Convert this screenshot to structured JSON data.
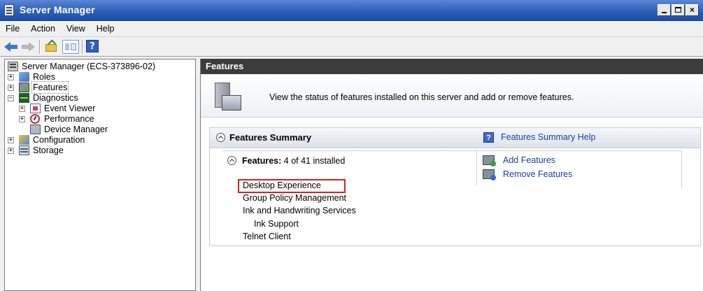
{
  "window": {
    "title": "Server Manager"
  },
  "menubar": [
    "File",
    "Action",
    "View",
    "Help"
  ],
  "toolbar": {
    "back": "back-icon",
    "forward": "forward-icon",
    "up": "folder-up-icon",
    "show_hide": "show-hide-tree-icon",
    "help": "?"
  },
  "tree": {
    "root": "Server Manager (ECS-373896-02)",
    "items": [
      {
        "label": "Roles"
      },
      {
        "label": "Features"
      },
      {
        "label": "Diagnostics"
      },
      {
        "label": "Event Viewer"
      },
      {
        "label": "Performance"
      },
      {
        "label": "Device Manager"
      },
      {
        "label": "Configuration"
      },
      {
        "label": "Storage"
      }
    ]
  },
  "main": {
    "header": "Features",
    "intro": "View the status of features installed on this server and add or remove features.",
    "summary": {
      "title": "Features Summary",
      "help_link": "Features Summary Help",
      "features_label": "Features:",
      "features_count": "4 of 41 installed",
      "installed": [
        "Desktop Experience",
        "Group Policy Management",
        "Ink and Handwriting Services",
        "Ink Support",
        "Telnet Client"
      ],
      "actions": {
        "add": "Add Features",
        "remove": "Remove Features"
      }
    }
  },
  "colors": {
    "titlebar": "#2b5fb8",
    "header_bg": "#3c3c3c",
    "link": "#1a3ea8",
    "highlight": "#d92020"
  }
}
